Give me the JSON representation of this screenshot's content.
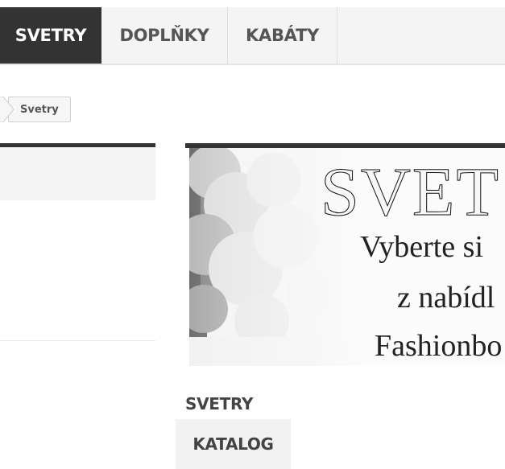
{
  "nav": {
    "items": [
      {
        "label": "SVETRY",
        "active": true
      },
      {
        "label": "DOPLŇKY",
        "active": false
      },
      {
        "label": "KABÁTY",
        "active": false
      }
    ]
  },
  "breadcrumb": {
    "current": "Svetry"
  },
  "banner": {
    "title": "SVET",
    "line1": "Vyberte si",
    "line2": "z nabídl",
    "line3": "Fashionbo"
  },
  "category": {
    "heading": "SVETRY",
    "catalog_label": "KATALOG"
  },
  "colors": {
    "nav_active_bg": "#333333",
    "nav_bg": "#f4f4f4",
    "accent_bar": "#333333"
  }
}
